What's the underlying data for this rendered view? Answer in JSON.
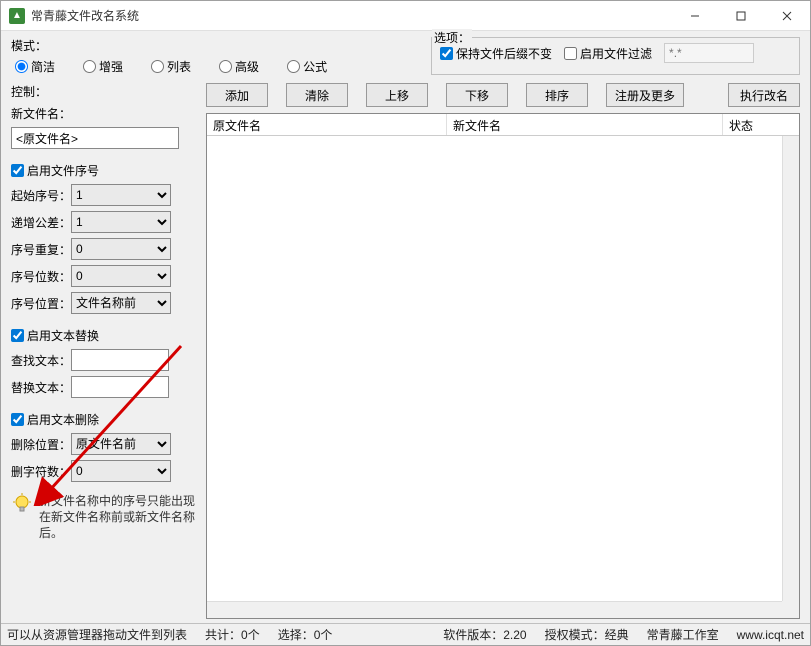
{
  "window": {
    "title": "常青藤文件改名系统"
  },
  "mode": {
    "label": "模式：",
    "options": [
      "简洁",
      "增强",
      "列表",
      "高级",
      "公式"
    ],
    "selected": "简洁"
  },
  "options": {
    "label": "选项：",
    "keep_ext": {
      "label": "保持文件后缀不变",
      "checked": true
    },
    "filter": {
      "label": "启用文件过滤",
      "checked": false,
      "placeholder": "*.*"
    }
  },
  "control": {
    "label": "控制：",
    "new_name": {
      "label": "新文件名：",
      "value": "<原文件名>"
    },
    "seq_enable": {
      "label": "启用文件序号",
      "checked": true
    },
    "start": {
      "label": "起始序号：",
      "value": "1"
    },
    "step": {
      "label": "递增公差：",
      "value": "1"
    },
    "repeat": {
      "label": "序号重复：",
      "value": "0"
    },
    "digits": {
      "label": "序号位数：",
      "value": "0"
    },
    "pos": {
      "label": "序号位置：",
      "value": "文件名称前"
    },
    "replace_enable": {
      "label": "启用文本替换",
      "checked": true
    },
    "find": {
      "label": "查找文本：",
      "value": ""
    },
    "replace": {
      "label": "替换文本：",
      "value": ""
    },
    "delete_enable": {
      "label": "启用文本删除",
      "checked": true
    },
    "del_pos": {
      "label": "删除位置：",
      "value": "原文件名前"
    },
    "del_cnt": {
      "label": "删字符数：",
      "value": "0"
    },
    "hint": "新文件名称中的序号只能出现在新文件名称前或新文件名称后。"
  },
  "buttons": {
    "add": "添加",
    "clear": "清除",
    "up": "上移",
    "down": "下移",
    "sort": "排序",
    "more": "注册及更多",
    "run": "执行改名"
  },
  "table": {
    "col1": "原文件名",
    "col2": "新文件名",
    "col3": "状态"
  },
  "status": {
    "drag": "可以从资源管理器拖动文件到列表",
    "total": "共计：0个",
    "select": "选择：0个",
    "version": "软件版本：2.20",
    "license": "授权模式：经典",
    "studio": "常青藤工作室",
    "url": "www.icqt.net"
  }
}
